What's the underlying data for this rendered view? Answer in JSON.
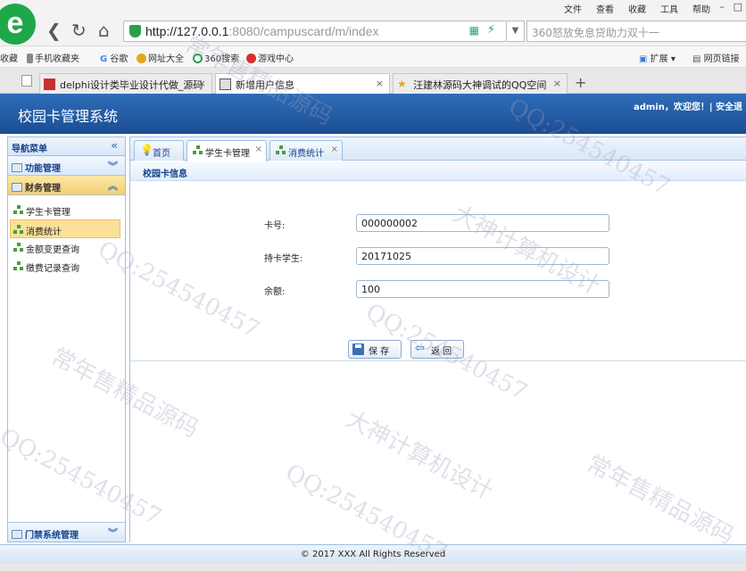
{
  "browser": {
    "menu": [
      "文件",
      "查看",
      "收藏",
      "工具",
      "帮助"
    ],
    "url_host": "http://127.0.0.1",
    "url_rest": ":8080/campuscard/m/index",
    "search_placeholder": "360怒放免息贷助力双十一",
    "favorites": [
      "收藏",
      "手机收藏夹",
      "谷歌",
      "网址大全",
      "360搜索",
      "游戏中心"
    ],
    "fav_right": [
      "扩展",
      "网页链接"
    ],
    "tabs": [
      {
        "label": "delphi设计类毕业设计代做_源码",
        "active": false
      },
      {
        "label": "新增用户信息",
        "active": true
      },
      {
        "label": "汪建林源码大神调试的QQ空间",
        "active": false
      }
    ],
    "colors": {
      "logo": "#1fa84a",
      "header": "#1c4d93"
    }
  },
  "app": {
    "title": "校园卡管理系统",
    "welcome": "admin，欢迎您！| 安全退"
  },
  "sidebar": {
    "title": "导航菜单",
    "sections": [
      {
        "label": "功能管理",
        "open": false
      },
      {
        "label": "财务管理",
        "open": true
      },
      {
        "label": "门禁系统管理",
        "open": false
      }
    ],
    "items": [
      {
        "label": "学生卡管理",
        "selected": false
      },
      {
        "label": "消费统计",
        "selected": true
      },
      {
        "label": "金额变更查询",
        "selected": false
      },
      {
        "label": "缴费记录查询",
        "selected": false
      }
    ]
  },
  "main": {
    "tabs": [
      {
        "label": "首页"
      },
      {
        "label": "学生卡管理"
      },
      {
        "label": "消费统计"
      }
    ],
    "panel_title": "校园卡信息",
    "form": [
      {
        "label": "卡号:",
        "value": "000000002"
      },
      {
        "label": "持卡学生:",
        "value": "20171025"
      },
      {
        "label": "余额:",
        "value": "100"
      }
    ],
    "save_label": "保 存",
    "back_label": "返 回"
  },
  "footer": "© 2017 XXX All Rights Reserved",
  "watermarks": [
    "QQ:254540457",
    "常年售精品源码",
    "大神计算机设计"
  ]
}
